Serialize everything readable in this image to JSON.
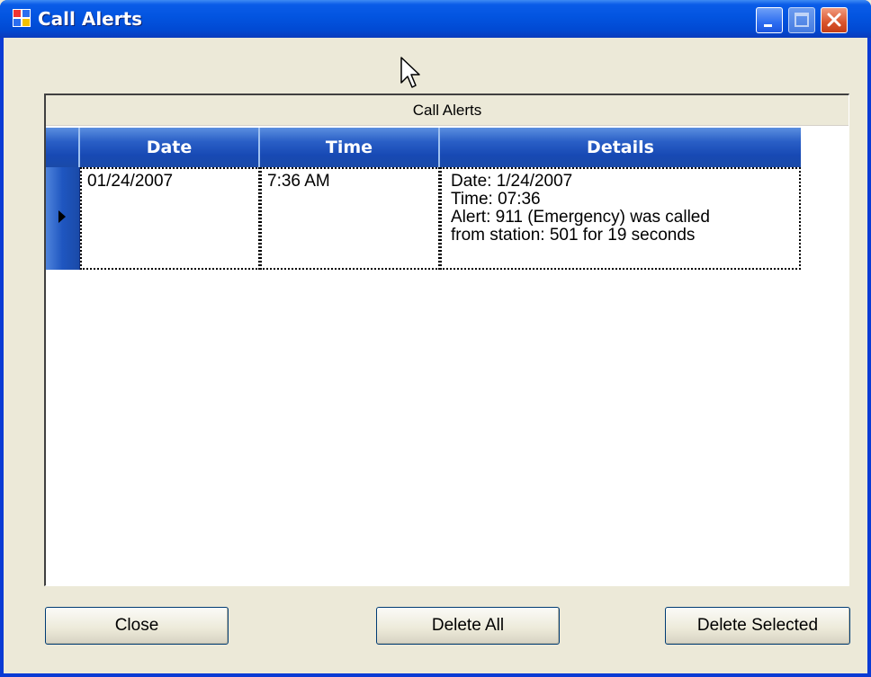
{
  "window": {
    "title": "Call Alerts"
  },
  "grid": {
    "caption": "Call Alerts",
    "columns": [
      "Date",
      "Time",
      "Details"
    ],
    "rows": [
      {
        "date": "01/24/2007",
        "time": "7:36 AM",
        "details": "Date: 1/24/2007\nTime: 07:36\nAlert: 911 (Emergency) was called\nfrom station: 501 for 19 seconds"
      }
    ]
  },
  "buttons": {
    "close": "Close",
    "delete_all": "Delete All",
    "delete_selected": "Delete Selected"
  },
  "icons": {
    "app": "app-window-icon",
    "minimize": "minimize-icon",
    "maximize": "maximize-icon",
    "close": "close-icon",
    "row_selector": "row-selector-arrow-icon",
    "cursor": "mouse-cursor-icon"
  }
}
